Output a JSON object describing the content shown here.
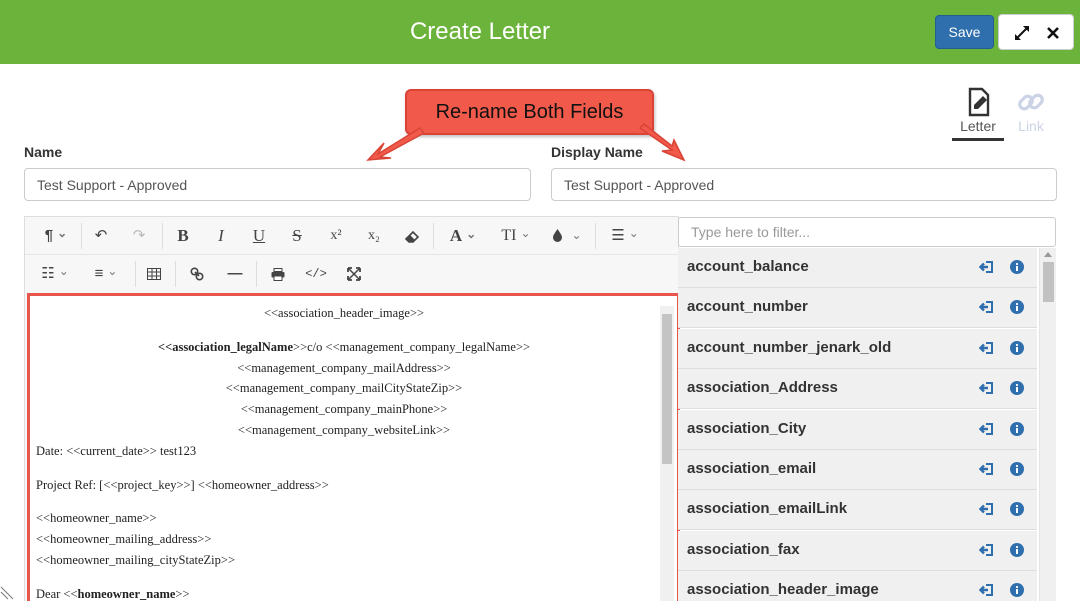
{
  "header": {
    "title": "Create Letter",
    "save_label": "Save"
  },
  "mode_tabs": {
    "letter": "Letter",
    "link": "Link"
  },
  "callout": {
    "text": "Re-name Both Fields"
  },
  "form": {
    "name_label": "Name",
    "name_value": "Test Support - Approved",
    "display_label": "Display Name",
    "display_value": "Test Support - Approved"
  },
  "toolbar": {
    "row1": [
      "paragraph-format",
      "undo",
      "redo",
      "bold",
      "italic",
      "underline",
      "strikethrough",
      "superscript",
      "subscript",
      "clear-formatting",
      "font-family",
      "font-size",
      "text-color",
      "unordered-list"
    ],
    "row2": [
      "ordered-list",
      "align",
      "table",
      "link",
      "horizontal-line",
      "print",
      "code-view",
      "fullscreen"
    ]
  },
  "document": {
    "lines": [
      {
        "text": "<<association_header_image>>",
        "align": "center"
      },
      {
        "bold": "<<association_legalName",
        "text": ">>c/o <<management_company_legalName>>",
        "align": "center"
      },
      {
        "text": "<<management_company_mailAddress>>",
        "align": "center"
      },
      {
        "text": "<<management_company_mailCityStateZip>>",
        "align": "center"
      },
      {
        "text": "<<management_company_mainPhone>>",
        "align": "center"
      },
      {
        "text": "<<management_company_websiteLink>>",
        "align": "center"
      },
      {
        "text": "Date: <<current_date>> test123",
        "align": "left"
      },
      {
        "text": "Project Ref: [<<project_key>>] <<homeowner_address>>",
        "align": "left"
      },
      {
        "text": "<<homeowner_name>>",
        "align": "left"
      },
      {
        "text": "<<homeowner_mailing_address>>",
        "align": "left"
      },
      {
        "text": "<<homeowner_mailing_cityStateZip>>",
        "align": "left"
      },
      {
        "text": "Dear <<",
        "bold": "homeowner_name",
        "tail": ">>",
        "align": "left"
      }
    ]
  },
  "fields_panel": {
    "filter_placeholder": "Type here to filter...",
    "items": [
      "account_balance",
      "account_number",
      "account_number_jenark_old",
      "association_Address",
      "association_City",
      "association_email",
      "association_emailLink",
      "association_fax",
      "association_header_image"
    ]
  },
  "colors": {
    "header_bg": "#6bb33a",
    "save_button": "#2f6fad",
    "callout": "#f15a4b",
    "action_icon": "#2f6fad"
  }
}
